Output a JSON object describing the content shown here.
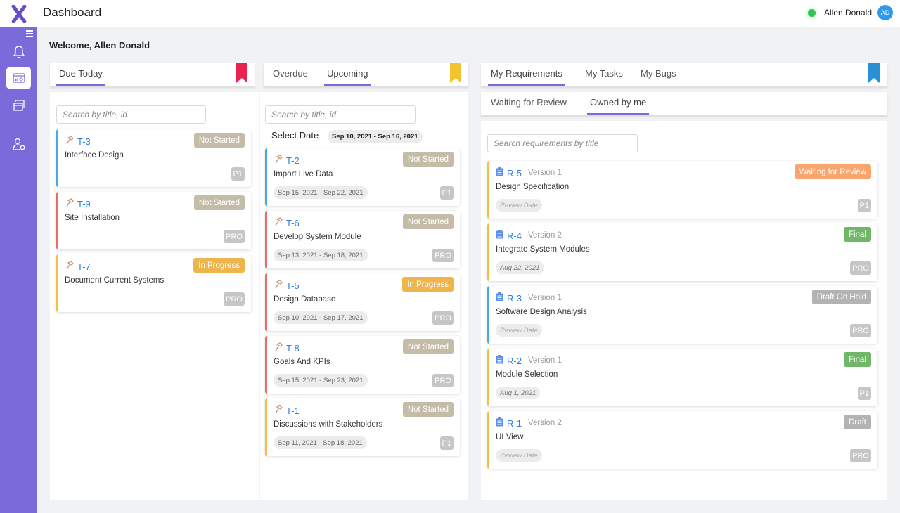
{
  "header": {
    "title": "Dashboard",
    "user_name": "Allen Donald",
    "avatar_initials": "AD",
    "online_status_color": "#2fc74d"
  },
  "sidebar": {
    "items": [
      {
        "icon": "bell-icon",
        "label": "Notifications"
      },
      {
        "icon": "dashboard-icon",
        "label": "Dashboard",
        "active": true
      },
      {
        "icon": "folder-icon",
        "label": "Projects"
      },
      {
        "icon": "user-settings-icon",
        "label": "Account"
      }
    ]
  },
  "welcome": "Welcome, Allen Donald",
  "due_panel": {
    "tabs": [
      {
        "label": "Due Today",
        "active": true
      }
    ],
    "ribbon_color": "#e8234e",
    "search_placeholder": "Search by title, id",
    "tasks": [
      {
        "id": "T-3",
        "title": "Interface Design",
        "status": "Not Started",
        "priority": "P1",
        "accent": "#4aa8e8"
      },
      {
        "id": "T-9",
        "title": "Site Installation",
        "status": "Not Started",
        "priority": "PRO",
        "accent": "#ec6b6b"
      },
      {
        "id": "T-7",
        "title": "Document Current Systems",
        "status": "In Progress",
        "priority": "PRO",
        "accent": "#f5be4a"
      }
    ]
  },
  "upcoming_panel": {
    "tabs": [
      {
        "label": "Overdue",
        "active": false
      },
      {
        "label": "Upcoming",
        "active": true
      }
    ],
    "ribbon_color": "#f4c430",
    "search_placeholder": "Search by title, id",
    "select_date_label": "Select Date",
    "date_range": "Sep 10, 2021 - Sep 16, 2021",
    "tasks": [
      {
        "id": "T-2",
        "title": "Import Live Data",
        "status": "Not Started",
        "priority": "P1",
        "dates": "Sep 15, 2021 - Sep 22, 2021",
        "accent": "#4aa8e8"
      },
      {
        "id": "T-6",
        "title": "Develop System Module",
        "status": "Not Started",
        "priority": "PRO",
        "dates": "Sep 13, 2021 - Sep 18, 2021",
        "accent": "#ec6b6b"
      },
      {
        "id": "T-5",
        "title": "Design Database",
        "status": "In Progress",
        "priority": "PRO",
        "dates": "Sep 10, 2021 - Sep 17, 2021",
        "accent": "#ec6b6b"
      },
      {
        "id": "T-8",
        "title": "Goals And KPIs",
        "status": "Not Started",
        "priority": "PRO",
        "dates": "Sep 15, 2021 - Sep 23, 2021",
        "accent": "#ec6b6b"
      },
      {
        "id": "T-1",
        "title": "Discussions with Stakeholders",
        "status": "Not Started",
        "priority": "P1",
        "dates": "Sep 11, 2021 - Sep 18, 2021",
        "accent": "#f5be4a"
      }
    ]
  },
  "requirements_panel": {
    "tabs": [
      {
        "label": "My Requirements",
        "active": true
      },
      {
        "label": "My Tasks",
        "active": false
      },
      {
        "label": "My Bugs",
        "active": false
      }
    ],
    "subtabs": [
      {
        "label": "Waiting for Review",
        "active": false
      },
      {
        "label": "Owned by me",
        "active": true
      }
    ],
    "ribbon_color": "#2b8fd6",
    "search_placeholder": "Search requirements by title",
    "items": [
      {
        "id": "R-5",
        "version": "Version 1",
        "title": "Design Specification",
        "status": "Waiting for Review",
        "priority": "P1",
        "review_date": "Review Date",
        "date_set": false,
        "accent": "#f5be4a"
      },
      {
        "id": "R-4",
        "version": "Version 2",
        "title": "Integrate System Modules",
        "status": "Final",
        "priority": "PRO",
        "review_date": "Aug 22, 2021",
        "date_set": true,
        "accent": "#f5be4a"
      },
      {
        "id": "R-3",
        "version": "Version 1",
        "title": "Software Design Analysis",
        "status": "Draft On Hold",
        "priority": "PRO",
        "review_date": "Review Date",
        "date_set": false,
        "accent": "#4aa8e8"
      },
      {
        "id": "R-2",
        "version": "Version 1",
        "title": "Module Selection",
        "status": "Final",
        "priority": "P1",
        "review_date": "Aug 1, 2021",
        "date_set": true,
        "accent": "#f5be4a"
      },
      {
        "id": "R-1",
        "version": "Version 2",
        "title": "UI View",
        "status": "Draft",
        "priority": "PRO",
        "review_date": "Review Date",
        "date_set": false,
        "accent": "#f5be4a"
      }
    ]
  },
  "status_colors": {
    "Not Started": "#c5bca8",
    "In Progress": "#efb54d",
    "Waiting for Review": "#fba46b",
    "Final": "#6fb868",
    "Draft On Hold": "#b3b3b3",
    "Draft": "#b3b3b3"
  }
}
